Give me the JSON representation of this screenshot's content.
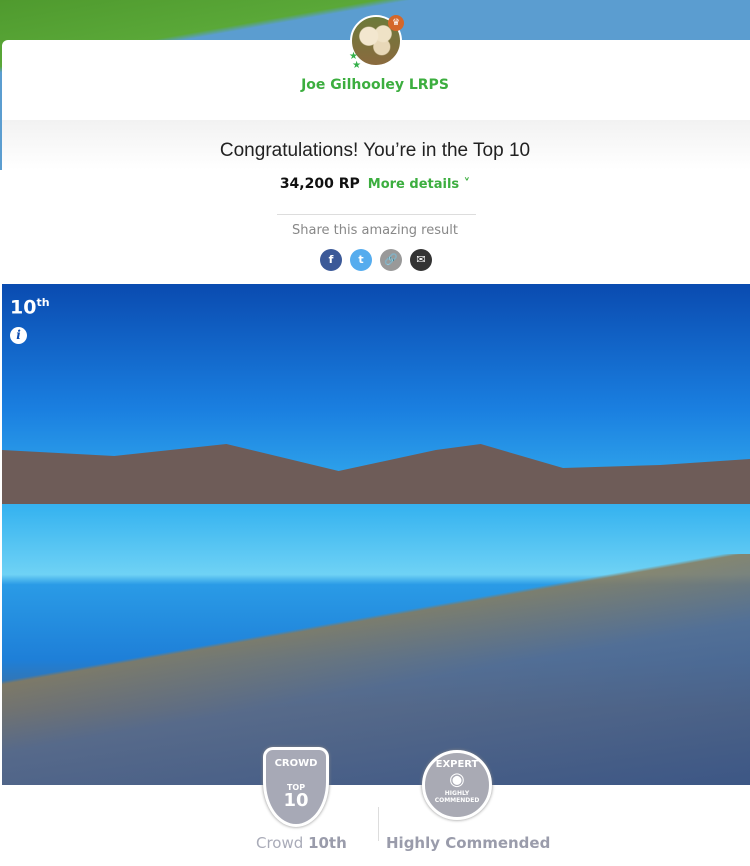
{
  "user": {
    "name": "Joe Gilhooley LRPS",
    "avatar": "owls-avatar",
    "badge_icon": "crown-icon"
  },
  "result": {
    "congrats": "Congratulations! You’re in the Top 10",
    "points": "34,200 RP",
    "more_details": "More details",
    "share_label": "Share this amazing result"
  },
  "share": [
    {
      "name": "facebook",
      "glyph": "f",
      "color": "#3b5998"
    },
    {
      "name": "twitter",
      "glyph": "t",
      "color": "#55acee"
    },
    {
      "name": "link",
      "glyph": "🔗",
      "color": "#999999"
    },
    {
      "name": "email",
      "glyph": "✉",
      "color": "#333333"
    }
  ],
  "photo": {
    "rank": "10",
    "rank_suffix": "th"
  },
  "awards": {
    "crowd_badge": {
      "top": "CROWD",
      "mid": "TOP",
      "num": "10"
    },
    "expert_badge": {
      "top": "EXPERT",
      "mid": "HIGHLY",
      "bottom": "COMMENDED"
    },
    "crowd_label": "Crowd",
    "crowd_rank": "10th",
    "expert_label": "Highly Commended"
  },
  "colors": {
    "accent": "#3cae3f",
    "crown": "#d4672a",
    "badge": "#a7a9b6"
  }
}
